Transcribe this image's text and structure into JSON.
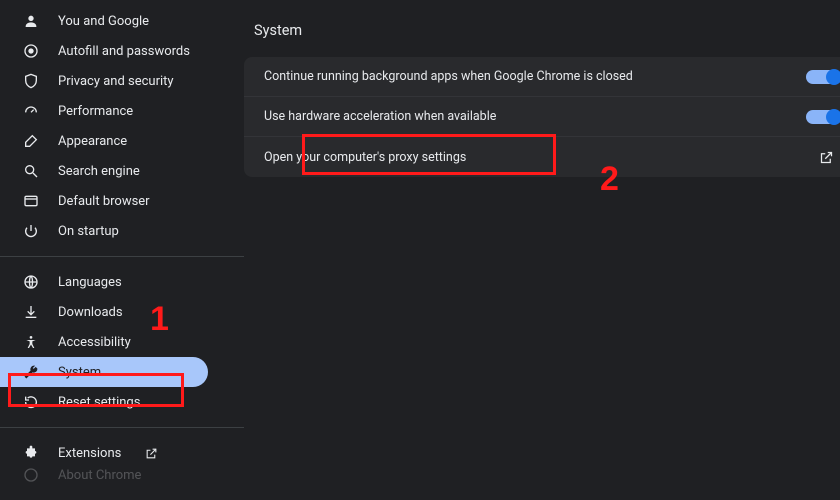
{
  "sidebar": {
    "group1": [
      {
        "label": "You and Google"
      },
      {
        "label": "Autofill and passwords"
      },
      {
        "label": "Privacy and security"
      },
      {
        "label": "Performance"
      },
      {
        "label": "Appearance"
      },
      {
        "label": "Search engine"
      },
      {
        "label": "Default browser"
      },
      {
        "label": "On startup"
      }
    ],
    "group2": [
      {
        "label": "Languages"
      },
      {
        "label": "Downloads"
      },
      {
        "label": "Accessibility"
      },
      {
        "label": "System"
      },
      {
        "label": "Reset settings"
      }
    ],
    "group3": [
      {
        "label": "Extensions"
      },
      {
        "label": "About Chrome"
      }
    ]
  },
  "main": {
    "title": "System",
    "rows": [
      {
        "label": "Continue running background apps when Google Chrome is closed"
      },
      {
        "label": "Use hardware acceleration when available"
      },
      {
        "label": "Open your computer's proxy settings"
      }
    ]
  },
  "annotations": {
    "n1": "1",
    "n2": "2"
  }
}
